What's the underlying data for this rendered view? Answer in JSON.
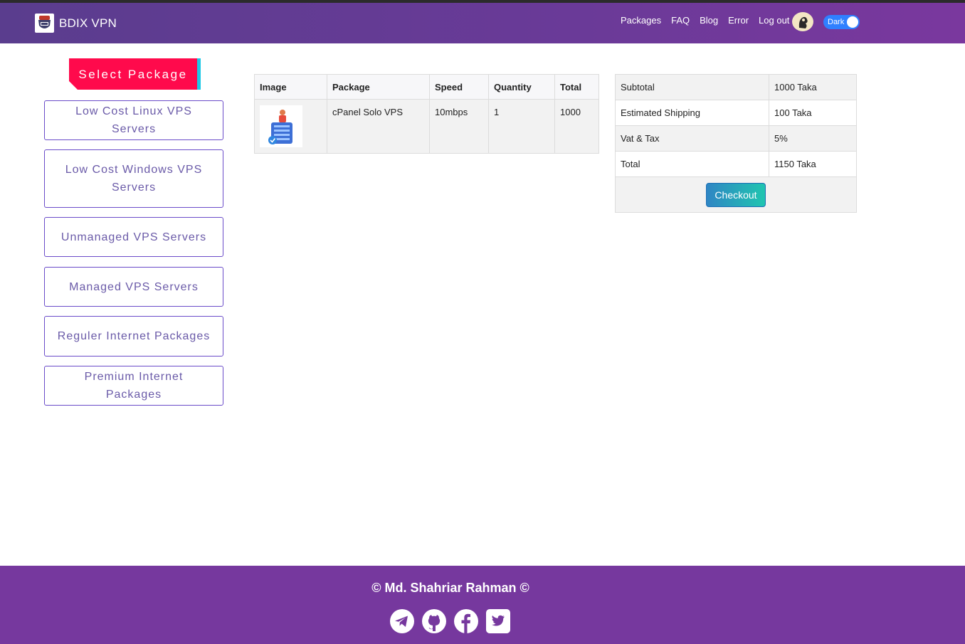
{
  "navbar": {
    "brand": "BDIX VPN",
    "links": [
      "Packages",
      "FAQ",
      "Blog",
      "Error",
      "Log out"
    ],
    "theme_toggle_label": "Dark"
  },
  "sidebar": {
    "title": "Select Package",
    "packages": [
      "Low Cost Linux VPS Servers",
      "Low Cost Windows VPS Servers",
      "Unmanaged VPS Servers",
      "Managed VPS Servers",
      "Reguler Internet Packages",
      "Premium Internet Packages"
    ]
  },
  "cart": {
    "headers": [
      "Image",
      "Package",
      "Speed",
      "Quantity",
      "Total"
    ],
    "rows": [
      {
        "package": "cPanel Solo VPS",
        "speed": "10mbps",
        "quantity": "1",
        "total": "1000"
      }
    ]
  },
  "summary": {
    "rows": [
      {
        "label": "Subtotal",
        "value": "1000 Taka"
      },
      {
        "label": "Estimated Shipping",
        "value": "100 Taka"
      },
      {
        "label": "Vat & Tax",
        "value": "5%"
      },
      {
        "label": "Total",
        "value": "1150 Taka"
      }
    ],
    "checkout_label": "Checkout"
  },
  "footer": {
    "copyright": "© Md. Shahriar Rahman ©",
    "social_icons": [
      "telegram-icon",
      "github-icon",
      "facebook-icon",
      "twitter-icon"
    ]
  },
  "colors": {
    "navbar": "#6a3a98",
    "footer": "#76389e",
    "select_package": "#ff0a4c",
    "package_border": "#6a4bc9",
    "toggle": "#2f80ff"
  }
}
